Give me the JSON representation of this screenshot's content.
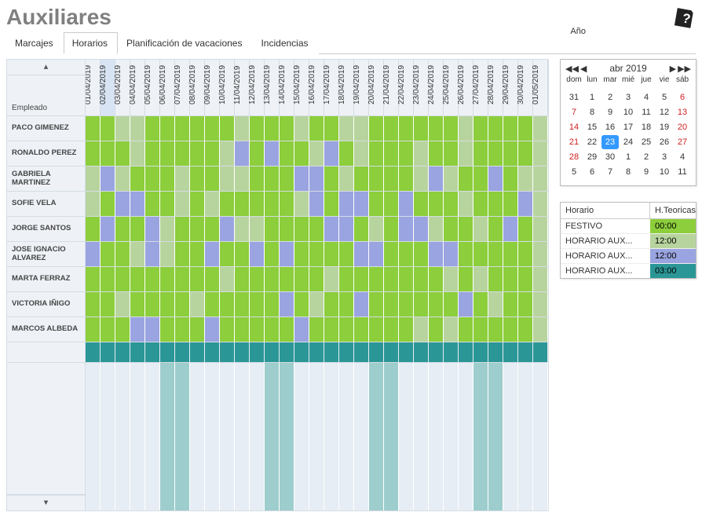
{
  "title": "Auxiliares",
  "year_label": "Año",
  "tabs": [
    "Marcajes",
    "Horarios",
    "Planificación de vacaciones",
    "Incidencias"
  ],
  "active_tab": 1,
  "emp_header": "Empleado",
  "employees": [
    "PACO GIMENEZ",
    "RONALDO PEREZ",
    "GABRIELA MARTINEZ",
    "SOFIE VELA",
    "JORGE SANTOS",
    "JOSE IGNACIO ALVAREZ",
    "MARTA FERRAZ",
    "VICTORIA IÑIGO",
    "MARCOS ALBEDA"
  ],
  "dates": [
    "01/04/2019",
    "02/04/2019",
    "03/04/2019",
    "04/04/2019",
    "05/04/2019",
    "06/04/2019",
    "07/04/2019",
    "08/04/2019",
    "09/04/2019",
    "10/04/2019",
    "11/04/2019",
    "12/04/2019",
    "13/04/2019",
    "14/04/2019",
    "15/04/2019",
    "16/04/2019",
    "17/04/2019",
    "18/04/2019",
    "19/04/2019",
    "20/04/2019",
    "21/04/2019",
    "22/04/2019",
    "23/04/2019",
    "24/04/2019",
    "25/04/2019",
    "26/04/2019",
    "27/04/2019",
    "28/04/2019",
    "29/04/2019",
    "30/04/2019",
    "01/05/2019"
  ],
  "selected_date_index": 1,
  "schedule_codes": {
    "F": "c-fest",
    "A": "c-aux1",
    "B": "c-aux2",
    "T": "c-aux3"
  },
  "schedule_rows": [
    "FFAAFFFFFFAFFFAFFAAFFFFFFAFFFFA",
    "FFFAFFFFFABFBFFABFAFFFAFFAFFFFA",
    "ABAFFFAFFAAFFFBBFAFFFFABAFFBFAA",
    "AFBBFFAFAFFFFFABFBBFFBFFFAFFFBA",
    "FBFFBAFFFBAAFFFFBBFAFBBAFFAFBFA",
    "BFFABAFFBFFBFBFFFFBBFFFBBFFFFFA",
    "FFFFFFFFFAFFFFFFAFFFFFFFAFAFFFA",
    "FFAFFFFAFFFFFBFAFFBFFFFFFBFAFFA",
    "FFFBBFFFBFFFFFBFFFFFFFAFAFFFFFA"
  ],
  "teal_row": true,
  "bottom_teal_cols": [
    5,
    6,
    12,
    13,
    19,
    20,
    26,
    27
  ],
  "calendar": {
    "title": "abr 2019",
    "day_headers": [
      "dom",
      "lun",
      "mar",
      "mié",
      "jue",
      "vie",
      "sáb"
    ],
    "weeks": [
      [
        {
          "n": 31
        },
        {
          "n": 1
        },
        {
          "n": 2
        },
        {
          "n": 3
        },
        {
          "n": 4
        },
        {
          "n": 5
        },
        {
          "n": 6,
          "red": true
        }
      ],
      [
        {
          "n": 7,
          "red": true
        },
        {
          "n": 8
        },
        {
          "n": 9
        },
        {
          "n": 10
        },
        {
          "n": 11
        },
        {
          "n": 12
        },
        {
          "n": 13,
          "red": true
        }
      ],
      [
        {
          "n": 14,
          "red": true
        },
        {
          "n": 15
        },
        {
          "n": 16
        },
        {
          "n": 17
        },
        {
          "n": 18
        },
        {
          "n": 19
        },
        {
          "n": 20,
          "red": true
        }
      ],
      [
        {
          "n": 21,
          "red": true
        },
        {
          "n": 22
        },
        {
          "n": 23,
          "sel": true
        },
        {
          "n": 24
        },
        {
          "n": 25
        },
        {
          "n": 26
        },
        {
          "n": 27,
          "red": true
        }
      ],
      [
        {
          "n": 28,
          "red": true
        },
        {
          "n": 29
        },
        {
          "n": 30
        },
        {
          "n": 1
        },
        {
          "n": 2
        },
        {
          "n": 3
        },
        {
          "n": 4
        }
      ],
      [
        {
          "n": 5
        },
        {
          "n": 6
        },
        {
          "n": 7
        },
        {
          "n": 8
        },
        {
          "n": 9
        },
        {
          "n": 10
        },
        {
          "n": 11
        }
      ]
    ]
  },
  "legend": {
    "col1": "Horario",
    "col2": "H.Teoricas",
    "rows": [
      {
        "name": "FESTIVO",
        "hours": "00:00",
        "cls": "c-fest"
      },
      {
        "name": "HORARIO AUX...",
        "hours": "12:00",
        "cls": "c-aux1"
      },
      {
        "name": "HORARIO AUX...",
        "hours": "12:00",
        "cls": "c-aux2"
      },
      {
        "name": "HORARIO AUX...",
        "hours": "03:00",
        "cls": "c-aux3"
      }
    ]
  }
}
